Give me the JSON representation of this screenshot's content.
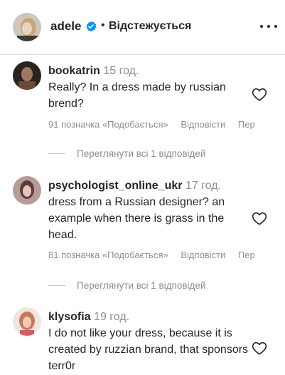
{
  "header": {
    "username": "adele",
    "separator": "•",
    "follow_status": "Відстежується"
  },
  "comments": [
    {
      "username": "bookatrin",
      "time": "15 год.",
      "text": "Really? In a dress made by russian brend?",
      "likes": "91 позначка «Подобається»",
      "reply_label": "Відповісти",
      "extra_label": "Пер",
      "view_replies": "Переглянути всі 1 відповідей"
    },
    {
      "username": "psychologist_online_ukr",
      "time": "17 год.",
      "text": "dress from a Russian designer? an example when there is grass in the head.",
      "likes": "81 позначка «Подобається»",
      "reply_label": "Відповісти",
      "extra_label": "Пер",
      "view_replies": "Переглянути всі 1 відповідей"
    },
    {
      "username": "klysofia",
      "time": "19 год.",
      "text": "I do not like your dress, because it is created by ruzzian brand, that sponsors terr0r"
    }
  ],
  "colors": {
    "text": "#262626",
    "secondary": "#8e8e8e",
    "verified": "#0095f6"
  },
  "icons": {
    "verified": "verified-badge-icon",
    "more": "more-options-icon",
    "like": "heart-outline-icon"
  }
}
